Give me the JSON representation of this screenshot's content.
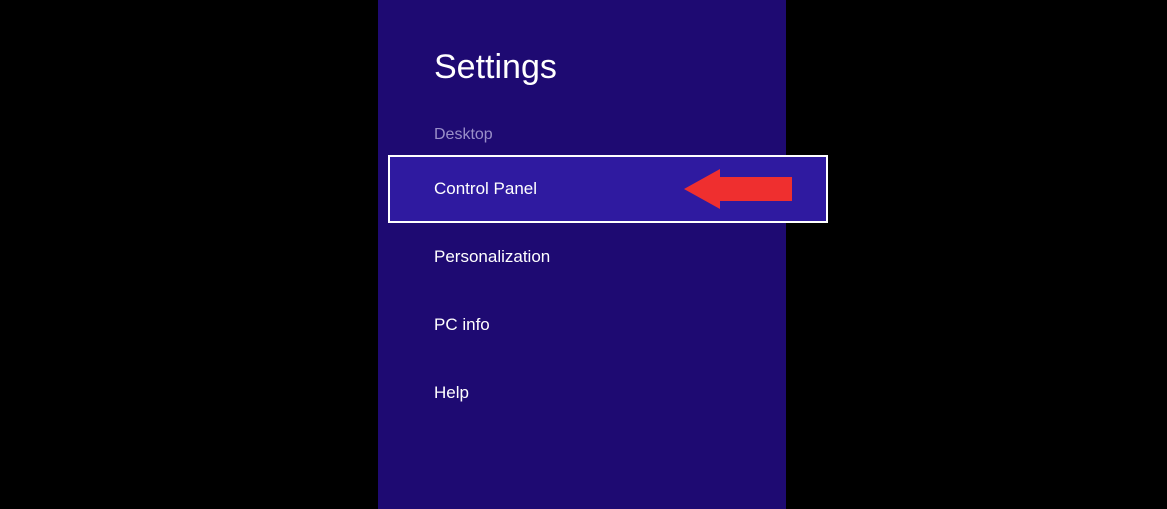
{
  "panel": {
    "title": "Settings",
    "context_label": "Desktop",
    "items": [
      {
        "label": "Control Panel",
        "selected": true
      },
      {
        "label": "Personalization",
        "selected": false
      },
      {
        "label": "PC info",
        "selected": false
      },
      {
        "label": "Help",
        "selected": false
      }
    ]
  },
  "annotation": {
    "type": "pointer-arrow",
    "color": "#ef2f2f",
    "points_at": "Control Panel"
  }
}
